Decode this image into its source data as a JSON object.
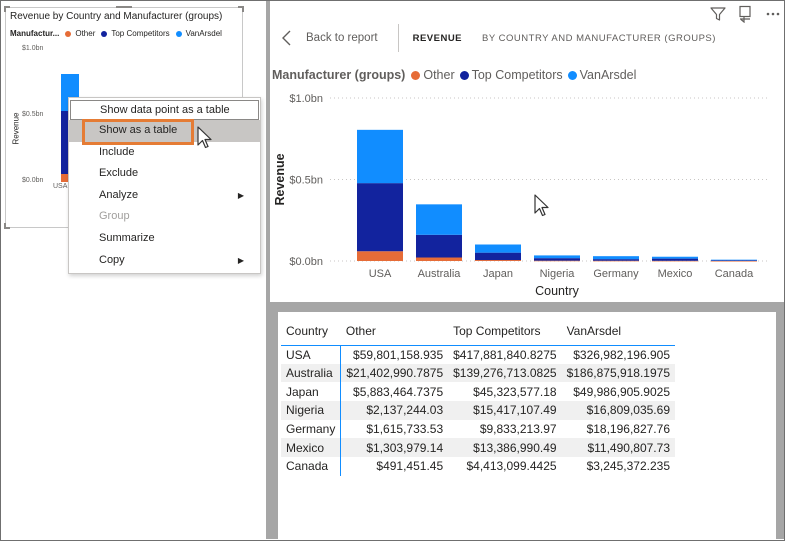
{
  "colors": {
    "other": "#e66c37",
    "top_competitors": "#12239e",
    "vanarsdel": "#118dff",
    "highlight": "#e57c35"
  },
  "mini_visual": {
    "title": "Revenue by Country and Manufacturer (groups)",
    "legend_title": "Manufactur...",
    "legend": [
      "Other",
      "Top Competitors",
      "VanArsdel"
    ],
    "y_ticks": [
      "$1.0bn",
      "$0.5bn",
      "$0.0bn"
    ],
    "y_label": "Revenue",
    "x_label": "USA"
  },
  "context_menu": {
    "items": [
      {
        "label": "Show data point as a table"
      },
      {
        "label": "Show as a table"
      },
      {
        "label": "Include"
      },
      {
        "label": "Exclude"
      },
      {
        "label": "Analyze",
        "submenu": true
      },
      {
        "label": "Group",
        "disabled": true
      },
      {
        "label": "Summarize"
      },
      {
        "label": "Copy",
        "submenu": true
      }
    ]
  },
  "toolbar": {
    "filter_icon": "filter-icon",
    "focus_icon": "focus-mode-icon",
    "more_icon": "more-options-icon"
  },
  "nav": {
    "back_label": "Back to report",
    "tab_active": "REVENUE",
    "tab_inactive": "BY COUNTRY AND MANUFACTURER (GROUPS)"
  },
  "legend": {
    "title": "Manufacturer (groups)",
    "entries": [
      "Other",
      "Top Competitors",
      "VanArsdel"
    ]
  },
  "chart_data": {
    "type": "bar",
    "stacked": true,
    "xlabel": "Country",
    "ylabel": "Revenue",
    "ylim": [
      0,
      1.0
    ],
    "y_ticks": [
      "$0.0bn",
      "$0.5bn",
      "$1.0bn"
    ],
    "categories": [
      "USA",
      "Australia",
      "Japan",
      "Nigeria",
      "Germany",
      "Mexico",
      "Canada"
    ],
    "series": [
      {
        "name": "Other",
        "values": [
          0.0598,
          0.0214,
          0.0059,
          0.0021,
          0.0016,
          0.0013,
          0.0005
        ]
      },
      {
        "name": "Top Competitors",
        "values": [
          0.4179,
          0.1393,
          0.0453,
          0.0154,
          0.0098,
          0.0134,
          0.0044
        ]
      },
      {
        "name": "VanArsdel",
        "values": [
          0.327,
          0.1869,
          0.05,
          0.0168,
          0.0182,
          0.0115,
          0.0032
        ]
      }
    ]
  },
  "table": {
    "headers": [
      "Country",
      "Other",
      "Top Competitors",
      "VanArsdel"
    ],
    "rows": [
      [
        "USA",
        "$59,801,158.935",
        "$417,881,840.8275",
        "$326,982,196.905"
      ],
      [
        "Australia",
        "$21,402,990.7875",
        "$139,276,713.0825",
        "$186,875,918.1975"
      ],
      [
        "Japan",
        "$5,883,464.7375",
        "$45,323,577.18",
        "$49,986,905.9025"
      ],
      [
        "Nigeria",
        "$2,137,244.03",
        "$15,417,107.49",
        "$16,809,035.69"
      ],
      [
        "Germany",
        "$1,615,733.53",
        "$9,833,213.97",
        "$18,196,827.76"
      ],
      [
        "Mexico",
        "$1,303,979.14",
        "$13,386,990.49",
        "$11,490,807.73"
      ],
      [
        "Canada",
        "$491,451.45",
        "$4,413,099.4425",
        "$3,245,372.235"
      ]
    ]
  }
}
